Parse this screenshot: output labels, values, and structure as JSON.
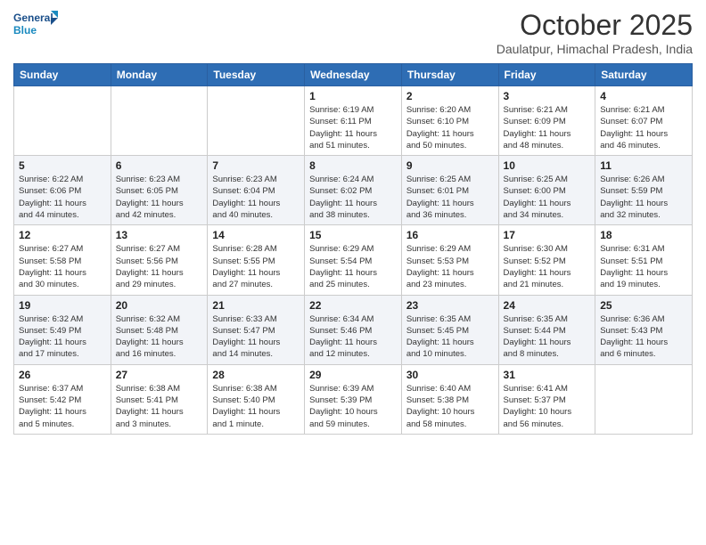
{
  "header": {
    "logo_line1": "General",
    "logo_line2": "Blue",
    "month": "October 2025",
    "location": "Daulatpur, Himachal Pradesh, India"
  },
  "weekdays": [
    "Sunday",
    "Monday",
    "Tuesday",
    "Wednesday",
    "Thursday",
    "Friday",
    "Saturday"
  ],
  "weeks": [
    [
      {
        "day": "",
        "info": ""
      },
      {
        "day": "",
        "info": ""
      },
      {
        "day": "",
        "info": ""
      },
      {
        "day": "1",
        "info": "Sunrise: 6:19 AM\nSunset: 6:11 PM\nDaylight: 11 hours\nand 51 minutes."
      },
      {
        "day": "2",
        "info": "Sunrise: 6:20 AM\nSunset: 6:10 PM\nDaylight: 11 hours\nand 50 minutes."
      },
      {
        "day": "3",
        "info": "Sunrise: 6:21 AM\nSunset: 6:09 PM\nDaylight: 11 hours\nand 48 minutes."
      },
      {
        "day": "4",
        "info": "Sunrise: 6:21 AM\nSunset: 6:07 PM\nDaylight: 11 hours\nand 46 minutes."
      }
    ],
    [
      {
        "day": "5",
        "info": "Sunrise: 6:22 AM\nSunset: 6:06 PM\nDaylight: 11 hours\nand 44 minutes."
      },
      {
        "day": "6",
        "info": "Sunrise: 6:23 AM\nSunset: 6:05 PM\nDaylight: 11 hours\nand 42 minutes."
      },
      {
        "day": "7",
        "info": "Sunrise: 6:23 AM\nSunset: 6:04 PM\nDaylight: 11 hours\nand 40 minutes."
      },
      {
        "day": "8",
        "info": "Sunrise: 6:24 AM\nSunset: 6:02 PM\nDaylight: 11 hours\nand 38 minutes."
      },
      {
        "day": "9",
        "info": "Sunrise: 6:25 AM\nSunset: 6:01 PM\nDaylight: 11 hours\nand 36 minutes."
      },
      {
        "day": "10",
        "info": "Sunrise: 6:25 AM\nSunset: 6:00 PM\nDaylight: 11 hours\nand 34 minutes."
      },
      {
        "day": "11",
        "info": "Sunrise: 6:26 AM\nSunset: 5:59 PM\nDaylight: 11 hours\nand 32 minutes."
      }
    ],
    [
      {
        "day": "12",
        "info": "Sunrise: 6:27 AM\nSunset: 5:58 PM\nDaylight: 11 hours\nand 30 minutes."
      },
      {
        "day": "13",
        "info": "Sunrise: 6:27 AM\nSunset: 5:56 PM\nDaylight: 11 hours\nand 29 minutes."
      },
      {
        "day": "14",
        "info": "Sunrise: 6:28 AM\nSunset: 5:55 PM\nDaylight: 11 hours\nand 27 minutes."
      },
      {
        "day": "15",
        "info": "Sunrise: 6:29 AM\nSunset: 5:54 PM\nDaylight: 11 hours\nand 25 minutes."
      },
      {
        "day": "16",
        "info": "Sunrise: 6:29 AM\nSunset: 5:53 PM\nDaylight: 11 hours\nand 23 minutes."
      },
      {
        "day": "17",
        "info": "Sunrise: 6:30 AM\nSunset: 5:52 PM\nDaylight: 11 hours\nand 21 minutes."
      },
      {
        "day": "18",
        "info": "Sunrise: 6:31 AM\nSunset: 5:51 PM\nDaylight: 11 hours\nand 19 minutes."
      }
    ],
    [
      {
        "day": "19",
        "info": "Sunrise: 6:32 AM\nSunset: 5:49 PM\nDaylight: 11 hours\nand 17 minutes."
      },
      {
        "day": "20",
        "info": "Sunrise: 6:32 AM\nSunset: 5:48 PM\nDaylight: 11 hours\nand 16 minutes."
      },
      {
        "day": "21",
        "info": "Sunrise: 6:33 AM\nSunset: 5:47 PM\nDaylight: 11 hours\nand 14 minutes."
      },
      {
        "day": "22",
        "info": "Sunrise: 6:34 AM\nSunset: 5:46 PM\nDaylight: 11 hours\nand 12 minutes."
      },
      {
        "day": "23",
        "info": "Sunrise: 6:35 AM\nSunset: 5:45 PM\nDaylight: 11 hours\nand 10 minutes."
      },
      {
        "day": "24",
        "info": "Sunrise: 6:35 AM\nSunset: 5:44 PM\nDaylight: 11 hours\nand 8 minutes."
      },
      {
        "day": "25",
        "info": "Sunrise: 6:36 AM\nSunset: 5:43 PM\nDaylight: 11 hours\nand 6 minutes."
      }
    ],
    [
      {
        "day": "26",
        "info": "Sunrise: 6:37 AM\nSunset: 5:42 PM\nDaylight: 11 hours\nand 5 minutes."
      },
      {
        "day": "27",
        "info": "Sunrise: 6:38 AM\nSunset: 5:41 PM\nDaylight: 11 hours\nand 3 minutes."
      },
      {
        "day": "28",
        "info": "Sunrise: 6:38 AM\nSunset: 5:40 PM\nDaylight: 11 hours\nand 1 minute."
      },
      {
        "day": "29",
        "info": "Sunrise: 6:39 AM\nSunset: 5:39 PM\nDaylight: 10 hours\nand 59 minutes."
      },
      {
        "day": "30",
        "info": "Sunrise: 6:40 AM\nSunset: 5:38 PM\nDaylight: 10 hours\nand 58 minutes."
      },
      {
        "day": "31",
        "info": "Sunrise: 6:41 AM\nSunset: 5:37 PM\nDaylight: 10 hours\nand 56 minutes."
      },
      {
        "day": "",
        "info": ""
      }
    ]
  ]
}
